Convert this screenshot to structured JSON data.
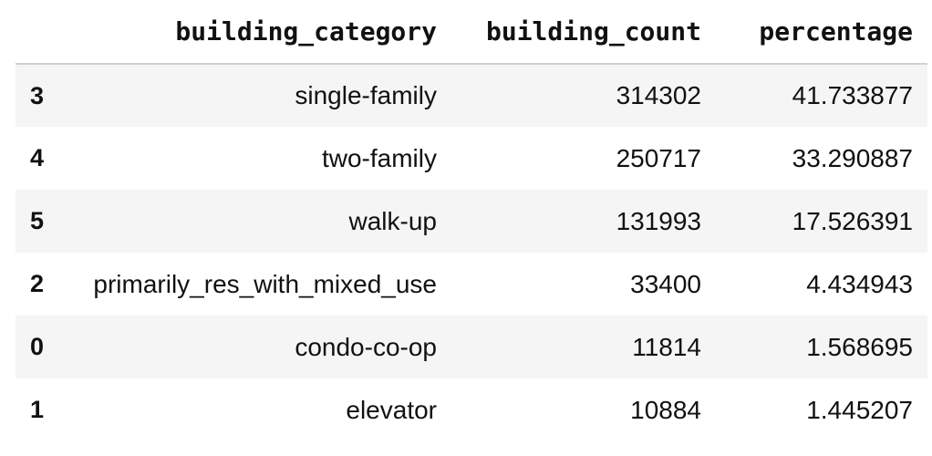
{
  "table": {
    "columns": {
      "index": "",
      "building_category": "building_category",
      "building_count": "building_count",
      "percentage": "percentage"
    },
    "rows": [
      {
        "index": "3",
        "building_category": "single-family",
        "building_count": "314302",
        "percentage": "41.733877"
      },
      {
        "index": "4",
        "building_category": "two-family",
        "building_count": "250717",
        "percentage": "33.290887"
      },
      {
        "index": "5",
        "building_category": "walk-up",
        "building_count": "131993",
        "percentage": "17.526391"
      },
      {
        "index": "2",
        "building_category": "primarily_res_with_mixed_use",
        "building_count": "33400",
        "percentage": "4.434943"
      },
      {
        "index": "0",
        "building_category": "condo-co-op",
        "building_count": "11814",
        "percentage": "1.568695"
      },
      {
        "index": "1",
        "building_category": "elevator",
        "building_count": "10884",
        "percentage": "1.445207"
      }
    ]
  },
  "colors": {
    "stripe": "#f5f5f5",
    "header_border": "#d0d0d0",
    "text": "#111111"
  }
}
